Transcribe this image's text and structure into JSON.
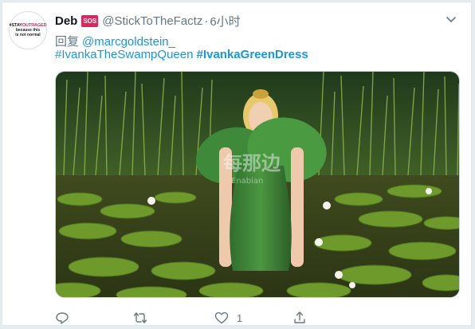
{
  "tweet": {
    "avatar": {
      "line1_prefix": "#STAY",
      "line1_red": "OUTRAGED",
      "line2": "because this",
      "line3": "is not normal"
    },
    "display_name": "Deb",
    "badge": "SOS",
    "handle": "@StickToTheFactz",
    "separator": "·",
    "time": "6小时",
    "reply_prefix": "回复",
    "reply_to": "@marcgoldstein_",
    "hashtags": [
      "#IvankaTheSwampQueen",
      "#IvankaGreenDress"
    ],
    "media": {
      "watermark": "每那边",
      "watermark_sub": "Enabian"
    },
    "actions": {
      "reply_count": "",
      "retweet_count": "",
      "like_count": "1",
      "share_count": ""
    }
  },
  "colors": {
    "link": "#1b95e0",
    "muted": "#657786",
    "badge": "#e0245e"
  },
  "icons": [
    "chevron-down-icon",
    "reply-icon",
    "retweet-icon",
    "like-icon",
    "share-icon"
  ]
}
